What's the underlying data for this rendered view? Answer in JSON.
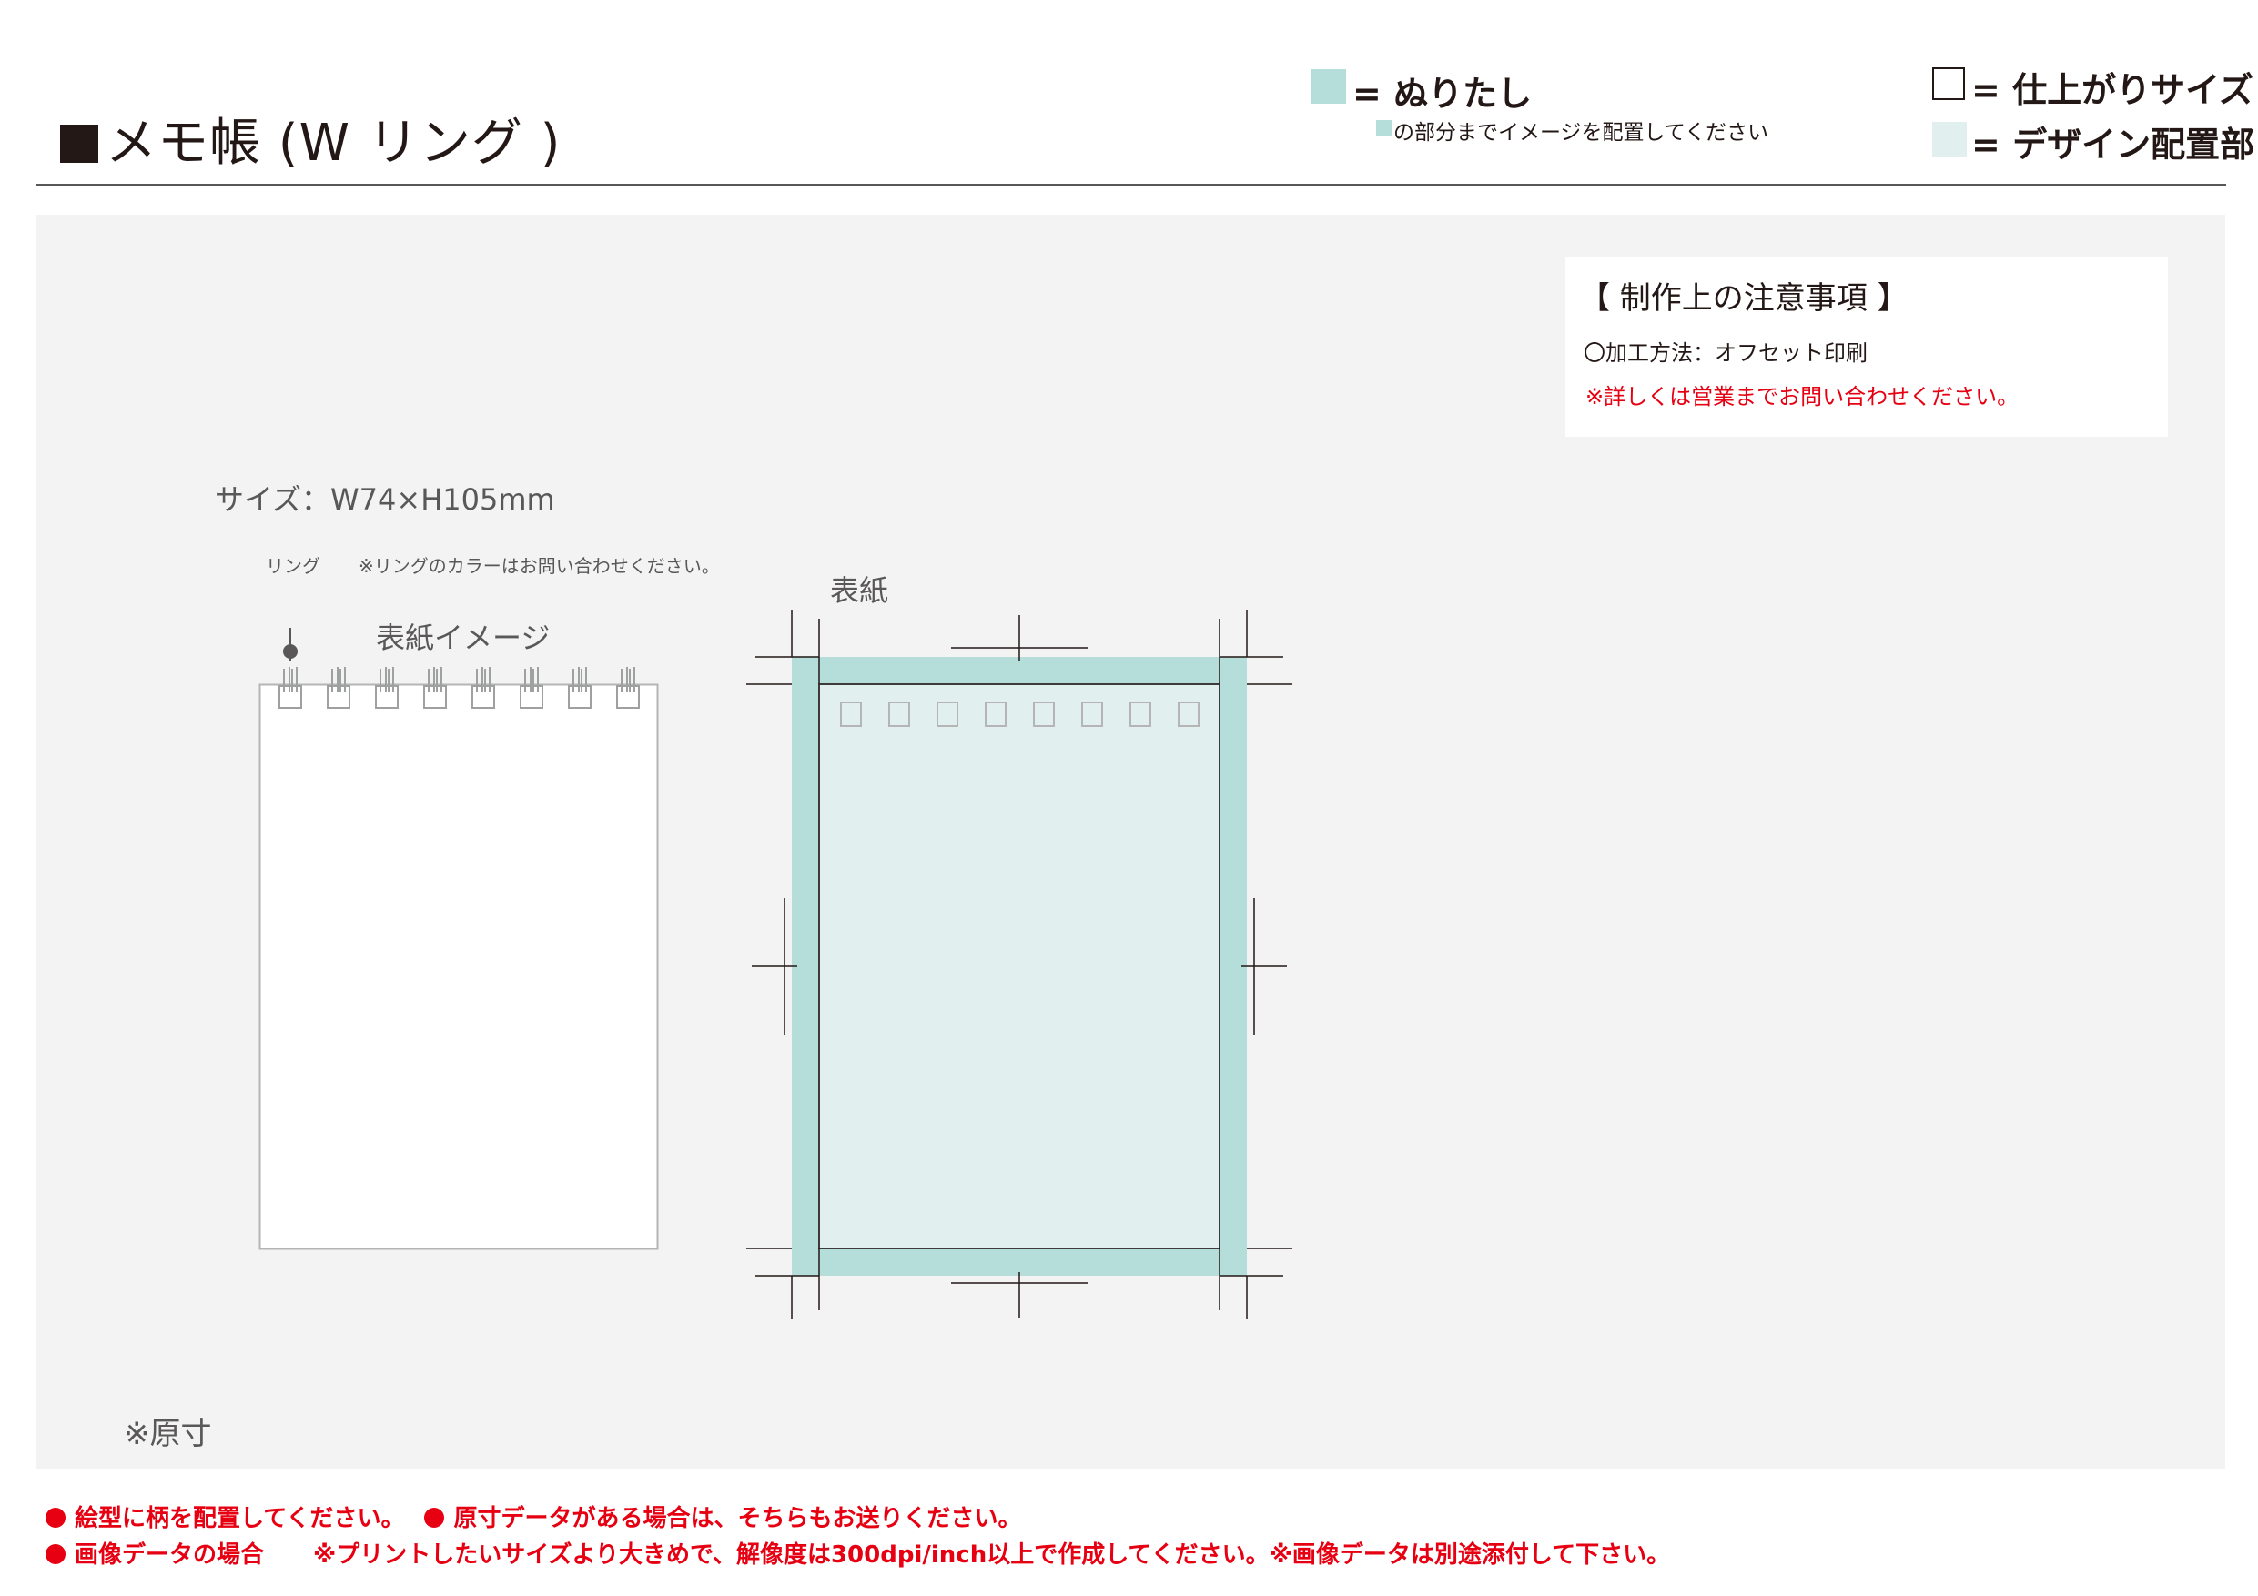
{
  "header": {
    "title": "メモ帳 (W リング )"
  },
  "legend": {
    "bleed_label": "= ぬりたし",
    "bleed_note": "の部分までイメージを配置してください",
    "trim_label": "= 仕上がりサイズ",
    "design_label": "= デザイン配置部"
  },
  "notes": {
    "title": "【 制作上の注意事項 】",
    "method": "〇加工方法：オフセット印刷",
    "contact": "※詳しくは営業までお問い合わせください。"
  },
  "figure": {
    "size_label": "サイズ：W74×H105mm",
    "ring_label": "リング",
    "ring_note": "※リングのカラーはお問い合わせください。",
    "cover_image_label": "表紙イメージ",
    "cover_label": "表紙",
    "actual_size": "※原寸"
  },
  "footer": {
    "line1_a": "絵型に柄を配置してください。",
    "line1_b": "原寸データがある場合は、そちらもお送りください。",
    "line2_a": "画像データの場合",
    "line2_b": "※プリントしたいサイズより大きめで、解像度は300dpi/inch以上で作成してください。※画像データは別途添付して下さい。"
  },
  "colors": {
    "bleed": "#b5ddd9",
    "design": "#e1f0ee",
    "accent_red": "#e60012",
    "panel": "#f3f3f3"
  }
}
